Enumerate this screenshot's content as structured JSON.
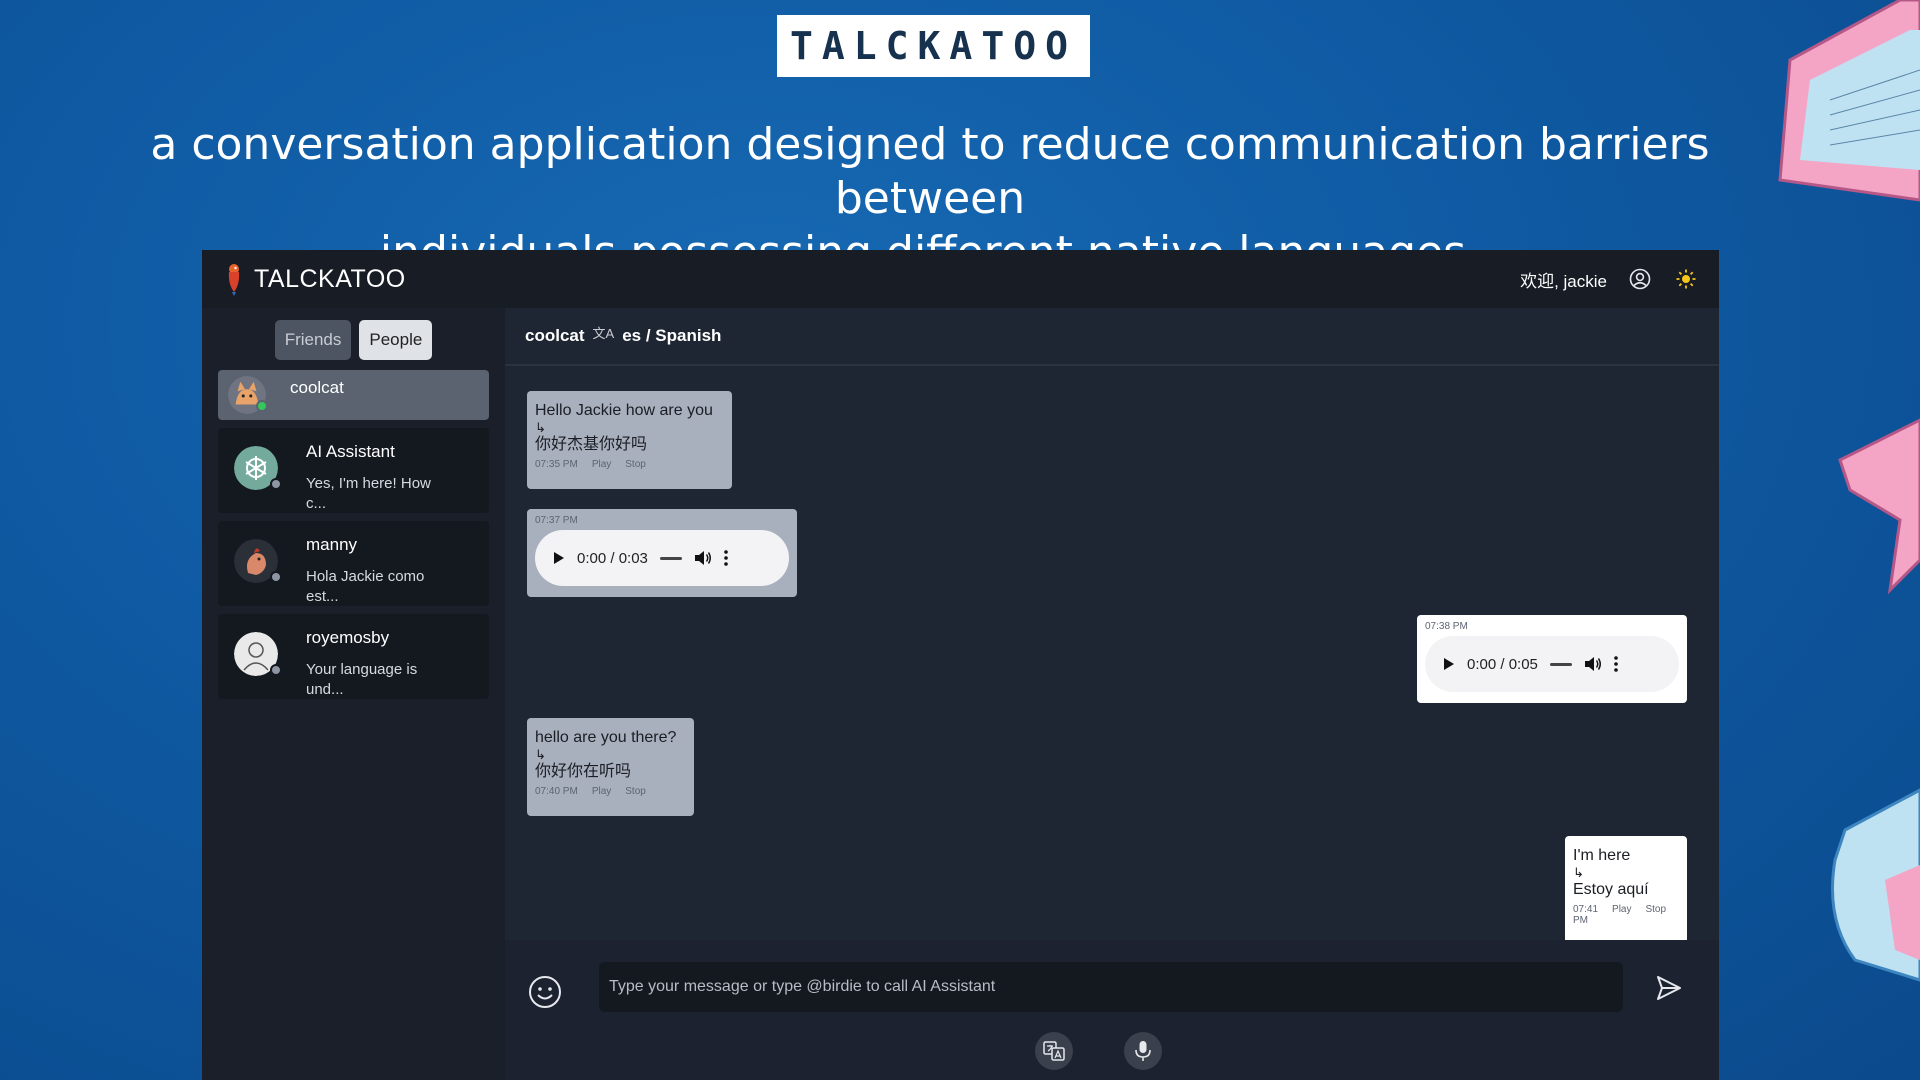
{
  "promo": {
    "logo": "TALCKATOO",
    "tagline_line1": "a conversation application designed to reduce communication barriers between",
    "tagline_line2": "individuals possessing different native languages."
  },
  "app": {
    "brand": "TALCKATOO",
    "welcome": "欢迎, jackie",
    "icons": [
      "parrot-logo-icon",
      "user-circle-icon",
      "sun-icon"
    ]
  },
  "sidebar": {
    "tabs": {
      "friends": "Friends",
      "people": "People"
    },
    "contacts": [
      {
        "name": "coolcat",
        "preview": "",
        "status": "online"
      },
      {
        "name": "AI Assistant",
        "preview": "Yes, I'm here! How c...",
        "status": "offline"
      },
      {
        "name": "manny",
        "preview": "Hola Jackie como est...",
        "status": "offline"
      },
      {
        "name": "royemosby",
        "preview": "Your language is und...",
        "status": "offline"
      }
    ]
  },
  "chat": {
    "contact": "coolcat",
    "language": "es / Spanish",
    "messages": [
      {
        "dir": "in",
        "text": "Hello Jackie how are you",
        "arrow": "↳",
        "translation": "你好杰基你好吗",
        "time": "07:35 PM",
        "play": "Play",
        "stop": "Stop"
      },
      {
        "dir": "in",
        "time": "07:37 PM",
        "audio": "0:00 / 0:03"
      },
      {
        "dir": "out",
        "time": "07:38 PM",
        "audio": "0:00 / 0:05"
      },
      {
        "dir": "in",
        "text": "hello are you there?",
        "arrow": "↳",
        "translation": "你好你在听吗",
        "time": "07:40 PM",
        "play": "Play",
        "stop": "Stop"
      },
      {
        "dir": "out",
        "text": "I'm here",
        "arrow": "↳",
        "translation": "Estoy aquí",
        "time": "07:41",
        "time2": "PM",
        "play": "Play",
        "stop": "Stop"
      }
    ],
    "input_placeholder": "Type your message or type @birdie to call AI Assistant"
  },
  "colors": {
    "bg_blue": "#0f5aa3",
    "app_dark": "#1f2633",
    "online": "#35c759",
    "accent_sun": "#f5c518"
  }
}
